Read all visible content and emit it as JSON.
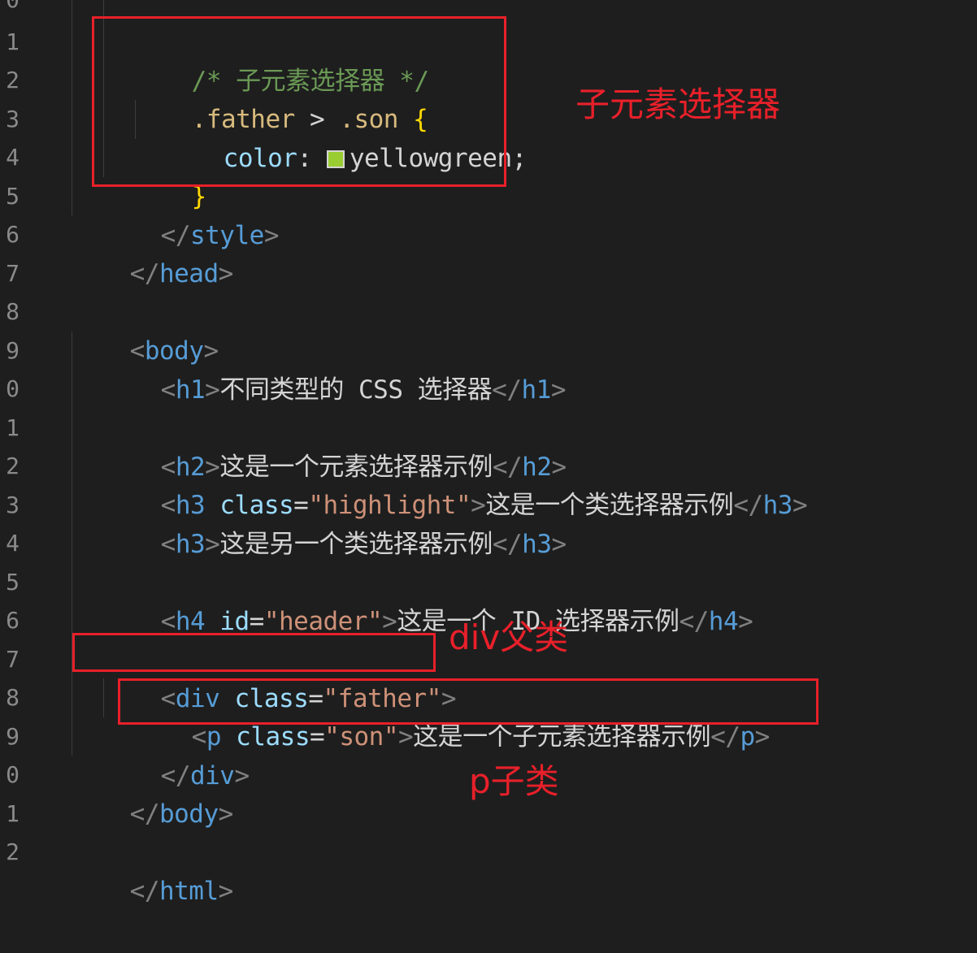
{
  "editor": {
    "line_numbers": [
      "0",
      "1",
      "2",
      "3",
      "4",
      "5",
      "6",
      "7",
      "8",
      "9",
      "0",
      "1",
      "2",
      "3",
      "4",
      "5",
      "6",
      "7",
      "8",
      "9",
      "0",
      "1",
      "2"
    ],
    "colors": {
      "background": "#1e1e1e",
      "annotation": "#e8202a",
      "swatch": "#9acd32"
    },
    "lines": {
      "l1": {
        "comment": "/* 子元素选择器 */"
      },
      "l2": {
        "sel1": ".father",
        "op": " > ",
        "sel2": ".son",
        "brace": " {"
      },
      "l3": {
        "prop": "color",
        "colon": ": ",
        "value": "yellowgreen",
        "semi": ";"
      },
      "l4": {
        "brace": "}"
      },
      "l5": {
        "open": "</",
        "tag": "style",
        "close": ">"
      },
      "l6": {
        "open": "</",
        "tag": "head",
        "close": ">"
      },
      "l8": {
        "open": "<",
        "tag": "body",
        "close": ">"
      },
      "l9": {
        "tag": "h1",
        "text": "不同类型的 CSS 选择器"
      },
      "l11": {
        "tag": "h2",
        "text": "这是一个元素选择器示例"
      },
      "l12": {
        "tag": "h3",
        "attr": "class",
        "value": "\"highlight\"",
        "text": "这是一个类选择器示例"
      },
      "l13": {
        "tag": "h3",
        "text": "这是另一个类选择器示例"
      },
      "l15": {
        "tag": "h4",
        "attr": "id",
        "value": "\"header\"",
        "text": "这是一个 ID 选择器示例"
      },
      "l17": {
        "tag": "div",
        "attr": "class",
        "value": "\"father\""
      },
      "l18": {
        "tag": "p",
        "attr": "class",
        "value": "\"son\"",
        "text": "这是一个子元素选择器示例"
      },
      "l19": {
        "tag": "div"
      },
      "l20": {
        "tag": "body"
      },
      "l22": {
        "tag": "html"
      }
    }
  },
  "annotations": {
    "child_selector": "子元素选择器",
    "div_parent": "div父类",
    "p_child": "p子类"
  }
}
